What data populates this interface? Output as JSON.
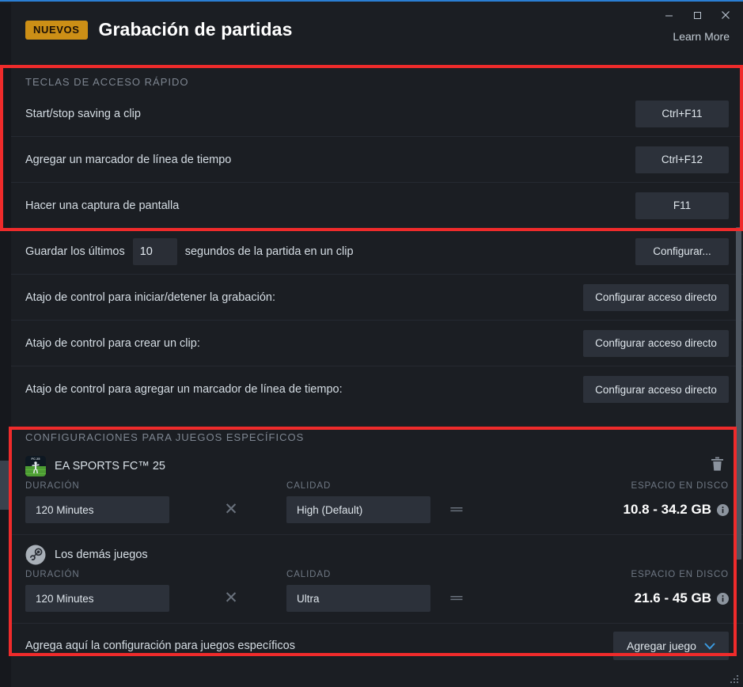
{
  "window": {
    "minimize_label": "minimize",
    "maximize_label": "maximize",
    "close_label": "close"
  },
  "header": {
    "badge": "NUEVOS",
    "title": "Grabación de partidas",
    "learn_more": "Learn More",
    "accent_color": "#2a7fd4",
    "badge_color": "#cc8f16"
  },
  "hotkeys_section": {
    "heading": "TECLAS DE ACCESO RÁPIDO",
    "rows": [
      {
        "label": "Start/stop saving a clip",
        "key": "Ctrl+F11"
      },
      {
        "label": "Agregar un marcador de línea de tiempo",
        "key": "Ctrl+F12"
      },
      {
        "label": "Hacer una captura de pantalla",
        "key": "F11"
      }
    ]
  },
  "clip_row": {
    "prefix": "Guardar los últimos",
    "seconds_value": "10",
    "suffix": "segundos de la partida en un clip",
    "button": "Configurar..."
  },
  "shortcut_rows": [
    {
      "label": "Atajo de control para iniciar/detener la grabación:",
      "button": "Configurar acceso directo"
    },
    {
      "label": "Atajo de control para crear un clip:",
      "button": "Configurar acceso directo"
    },
    {
      "label": "Atajo de control para agregar un marcador de línea de tiempo:",
      "button": "Configurar acceso directo"
    }
  ],
  "games_section": {
    "heading": "CONFIGURACIONES PARA JUEGOS ESPECÍFICOS",
    "columns": {
      "duration": "DURACIÓN",
      "quality": "CALIDAD",
      "disk": "ESPACIO EN DISCO"
    },
    "operators": {
      "multiply": "✕",
      "equals": "═"
    },
    "games": [
      {
        "name": "EA SPORTS FC™ 25",
        "icon": "ea-sports-fc-icon",
        "duration": "120 Minutes",
        "quality": "High (Default)",
        "disk_space": "10.8 - 34.2 GB",
        "has_delete": true
      },
      {
        "name": "Los demás juegos",
        "icon": "steam-icon",
        "duration": "120 Minutes",
        "quality": "Ultra",
        "disk_space": "21.6 - 45 GB",
        "has_delete": false
      }
    ]
  },
  "add_game_row": {
    "text": "Agrega aquí la configuración para juegos específicos",
    "button": "Agregar juego",
    "chevron_color": "#3b9ae0"
  },
  "annotations": {
    "color": "#ef2b2b",
    "boxes": [
      "hotkeys-section-highlight",
      "games-section-highlight"
    ]
  }
}
